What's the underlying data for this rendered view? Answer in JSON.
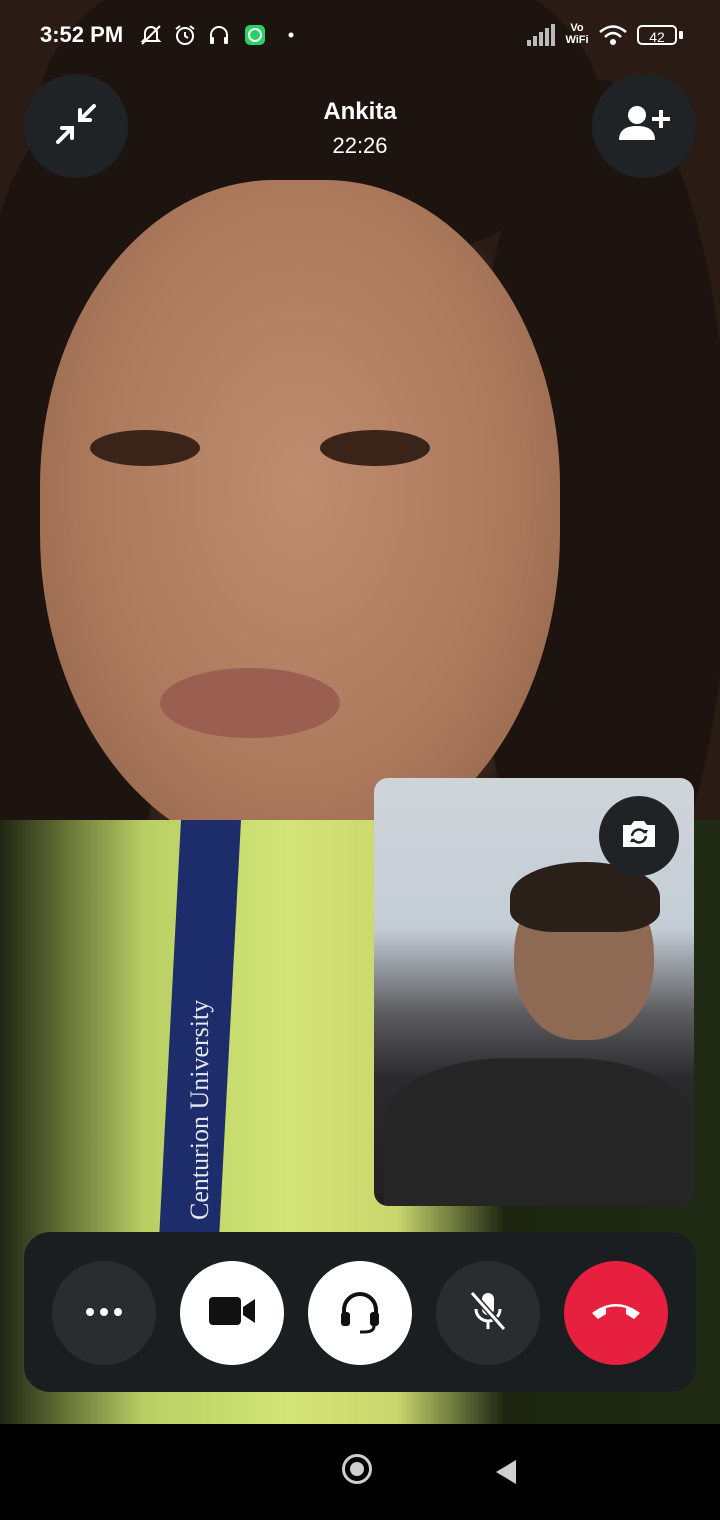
{
  "status_bar": {
    "time": "3:52 PM",
    "icons": [
      "mute-notifications-icon",
      "alarm-icon",
      "headset-icon",
      "whatsapp-icon",
      "signal-icon",
      "vowifi-icon",
      "wifi-icon"
    ],
    "vowifi_top": "Vo",
    "vowifi_bottom": "WiFi",
    "battery": "42"
  },
  "call": {
    "contact_name": "Ankita",
    "duration": "22:26",
    "lanyard_text": "Centurion University"
  },
  "controls": {
    "icons": [
      "more-options-icon",
      "video-camera-icon",
      "headset-icon",
      "mic-off-icon",
      "end-call-icon"
    ],
    "end_call_color": "#e8203f"
  }
}
